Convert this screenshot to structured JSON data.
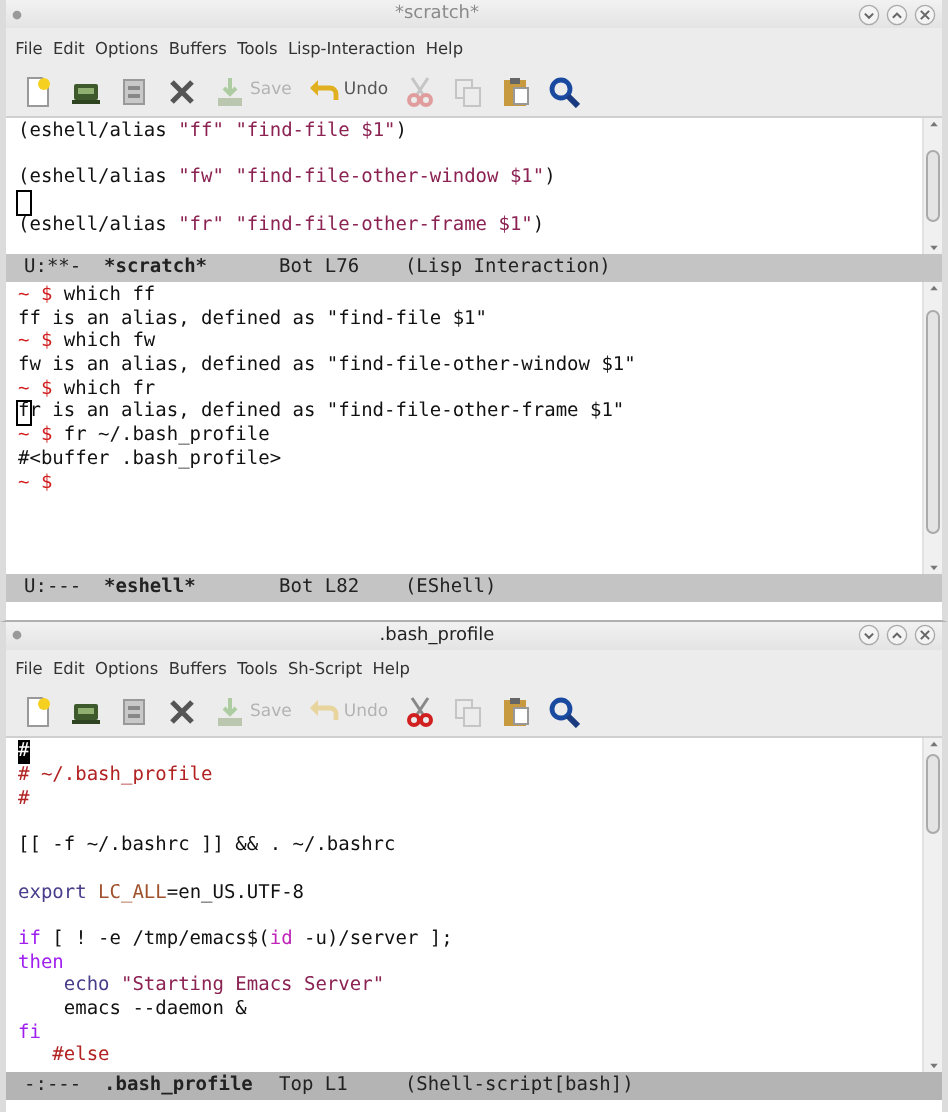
{
  "frames": [
    {
      "title": "*scratch*",
      "active": false,
      "menu": [
        "File",
        "Edit",
        "Options",
        "Buffers",
        "Tools",
        "Lisp-Interaction",
        "Help"
      ],
      "toolbar": [
        {
          "kind": "new",
          "disabled": false
        },
        {
          "kind": "open",
          "disabled": false
        },
        {
          "kind": "dired",
          "disabled": false
        },
        {
          "kind": "close",
          "disabled": false
        },
        {
          "kind": "save",
          "label": "Save",
          "disabled": true
        },
        {
          "kind": "undo",
          "label": "Undo",
          "disabled": false
        },
        {
          "kind": "cut",
          "disabled": true
        },
        {
          "kind": "copy",
          "disabled": true
        },
        {
          "kind": "paste",
          "disabled": false
        },
        {
          "kind": "search",
          "disabled": false
        }
      ],
      "windows": [
        {
          "lines": [
            {
              "kind": "code",
              "segments": [
                {
                  "kind": "plain",
                  "text": "(eshell/alias "
                },
                {
                  "kind": "string",
                  "text": "\"ff\""
                },
                {
                  "kind": "string",
                  "text": " \"find-file $1\""
                },
                {
                  "kind": "plain",
                  "text": ")"
                }
              ]
            },
            {
              "kind": "blank"
            },
            {
              "kind": "code",
              "segments": [
                {
                  "kind": "plain",
                  "text": "(eshell/alias "
                },
                {
                  "kind": "string",
                  "text": "\"fw\""
                },
                {
                  "kind": "string",
                  "text": " \"find-file-other-window $1\""
                },
                {
                  "kind": "plain",
                  "text": ")"
                }
              ]
            },
            {
              "kind": "blank",
              "cursor": true
            },
            {
              "kind": "code",
              "segments": [
                {
                  "kind": "plain",
                  "text": "(eshell/alias "
                },
                {
                  "kind": "string",
                  "text": "\"fr\""
                },
                {
                  "kind": "string",
                  "text": " \"find-file-other-frame $1\""
                },
                {
                  "kind": "plain",
                  "text": ")"
                }
              ]
            }
          ],
          "mode_line": {
            "status": "U:**-",
            "buffer": "*scratch*",
            "position": "Bot L76",
            "mode": "(Lisp Interaction)"
          }
        },
        {
          "lines": [
            {
              "kind": "code",
              "segments": [
                {
                  "kind": "prompt",
                  "text": "~ $"
                },
                {
                  "kind": "plain",
                  "text": " which ff"
                }
              ]
            },
            {
              "kind": "code",
              "segments": [
                {
                  "kind": "plain",
                  "text": "ff is an alias, defined as \"find-file $1\""
                }
              ]
            },
            {
              "kind": "code",
              "segments": [
                {
                  "kind": "prompt",
                  "text": "~ $"
                },
                {
                  "kind": "plain",
                  "text": " which fw"
                }
              ]
            },
            {
              "kind": "code",
              "segments": [
                {
                  "kind": "plain",
                  "text": "fw is an alias, defined as \"find-file-other-window $1\""
                }
              ]
            },
            {
              "kind": "code",
              "segments": [
                {
                  "kind": "prompt",
                  "text": "~ $"
                },
                {
                  "kind": "plain",
                  "text": " which fr"
                }
              ]
            },
            {
              "kind": "code",
              "cursor": true,
              "segments": [
                {
                  "kind": "plain",
                  "text": "fr is an alias, defined as \"find-file-other-frame $1\""
                }
              ]
            },
            {
              "kind": "code",
              "segments": [
                {
                  "kind": "prompt",
                  "text": "~ $"
                },
                {
                  "kind": "plain",
                  "text": " fr ~/.bash_profile"
                }
              ]
            },
            {
              "kind": "code",
              "segments": [
                {
                  "kind": "plain",
                  "text": "#<buffer .bash_profile>"
                }
              ]
            },
            {
              "kind": "code",
              "segments": [
                {
                  "kind": "prompt",
                  "text": "~ $"
                }
              ]
            }
          ],
          "mode_line": {
            "status": "U:---",
            "buffer": "*eshell*",
            "position": "Bot L82",
            "mode": "(EShell)"
          }
        }
      ]
    },
    {
      "title": ".bash_profile",
      "active": true,
      "menu": [
        "File",
        "Edit",
        "Options",
        "Buffers",
        "Tools",
        "Sh-Script",
        "Help"
      ],
      "toolbar": [
        {
          "kind": "new",
          "disabled": false
        },
        {
          "kind": "open",
          "disabled": false
        },
        {
          "kind": "dired",
          "disabled": false
        },
        {
          "kind": "close",
          "disabled": false
        },
        {
          "kind": "save",
          "label": "Save",
          "disabled": true
        },
        {
          "kind": "undo",
          "label": "Undo",
          "disabled": true
        },
        {
          "kind": "cut",
          "disabled": false
        },
        {
          "kind": "copy",
          "disabled": true
        },
        {
          "kind": "paste",
          "disabled": false
        },
        {
          "kind": "search",
          "disabled": false
        }
      ],
      "windows": [
        {
          "lines": [
            {
              "kind": "code",
              "cursor": true,
              "segments": [
                {
                  "kind": "comment",
                  "text": "#"
                }
              ]
            },
            {
              "kind": "code",
              "segments": [
                {
                  "kind": "comment",
                  "text": "# ~/.bash_profile"
                }
              ]
            },
            {
              "kind": "code",
              "segments": [
                {
                  "kind": "comment",
                  "text": "#"
                }
              ]
            },
            {
              "kind": "blank"
            },
            {
              "kind": "code",
              "segments": [
                {
                  "kind": "plain",
                  "text": "[[ -f ~/.bashrc ]] && . ~/.bashrc"
                }
              ]
            },
            {
              "kind": "blank"
            },
            {
              "kind": "code",
              "segments": [
                {
                  "kind": "builtin",
                  "text": "export"
                },
                {
                  "kind": "variable",
                  "text": " LC_ALL"
                },
                {
                  "kind": "plain",
                  "text": "=en_US.UTF-8"
                }
              ]
            },
            {
              "kind": "blank"
            },
            {
              "kind": "code",
              "segments": [
                {
                  "kind": "keyword",
                  "text": "if"
                },
                {
                  "kind": "plain",
                  "text": " [ ! -e /tmp/emacs$("
                },
                {
                  "kind": "command",
                  "text": "id"
                },
                {
                  "kind": "plain",
                  "text": " -u)/server ];"
                }
              ]
            },
            {
              "kind": "code",
              "segments": [
                {
                  "kind": "keyword",
                  "text": "then"
                }
              ]
            },
            {
              "kind": "code",
              "segments": [
                {
                  "kind": "builtin",
                  "text": "    echo"
                },
                {
                  "kind": "string",
                  "text": " \"Starting Emacs Server\""
                }
              ]
            },
            {
              "kind": "code",
              "segments": [
                {
                  "kind": "plain",
                  "text": "    emacs --daemon &"
                }
              ]
            },
            {
              "kind": "code",
              "segments": [
                {
                  "kind": "keyword",
                  "text": "fi"
                }
              ]
            },
            {
              "kind": "code",
              "segments": [
                {
                  "kind": "comment",
                  "text": "   #else"
                }
              ]
            }
          ],
          "mode_line": {
            "status": "-:---",
            "buffer": ".bash_profile",
            "position": "Top L1",
            "mode": "(Shell-script[bash])"
          }
        }
      ]
    }
  ]
}
